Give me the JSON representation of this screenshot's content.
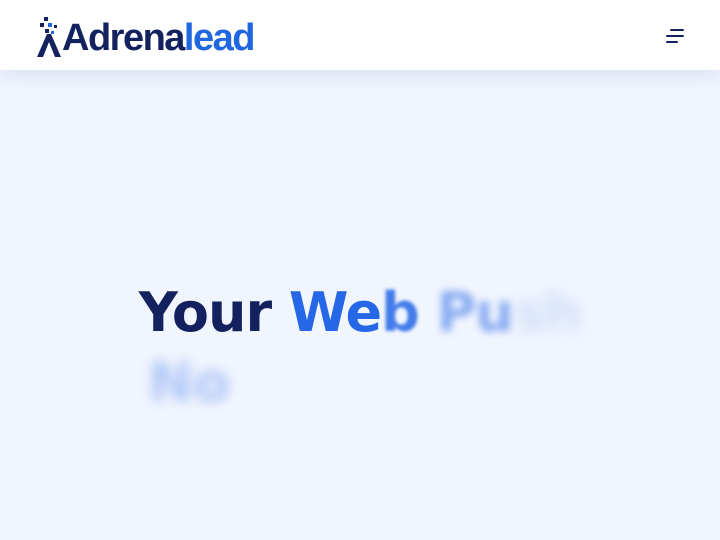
{
  "header": {
    "logo": {
      "text_dark": "Adrena",
      "text_blue": "lead",
      "icon": "sparkle-logo-icon"
    },
    "menu_icon": "hamburger-menu-icon"
  },
  "hero": {
    "headline": {
      "word1": "Your",
      "word2": "We",
      "word2b": "b",
      "word3": "Pu",
      "word3b": "sh",
      "line2": "No"
    }
  },
  "colors": {
    "navy": "#13225e",
    "brand_blue": "#1f66e0",
    "background": "#f1f5fe"
  }
}
